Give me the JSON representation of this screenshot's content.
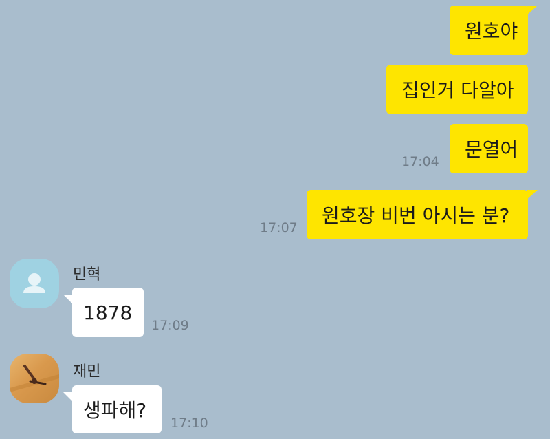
{
  "messages_sent": [
    {
      "text": "원호야",
      "time": ""
    },
    {
      "text": "집인거 다알아",
      "time": ""
    },
    {
      "text": "문열어",
      "time": "17:04"
    },
    {
      "text": "원호장 비번 아시는 분?",
      "time": "17:07"
    }
  ],
  "messages_received": [
    {
      "sender": "민혁",
      "text": "1878",
      "time": "17:09",
      "avatar": "default-profile-icon"
    },
    {
      "sender": "재민",
      "text": "생파해?",
      "time": "17:10",
      "avatar": "photo-profile"
    }
  ],
  "colors": {
    "background": "#a9bdcd",
    "sent_bubble": "#fee500",
    "received_bubble": "#ffffff",
    "timestamp": "#6f7c88"
  }
}
